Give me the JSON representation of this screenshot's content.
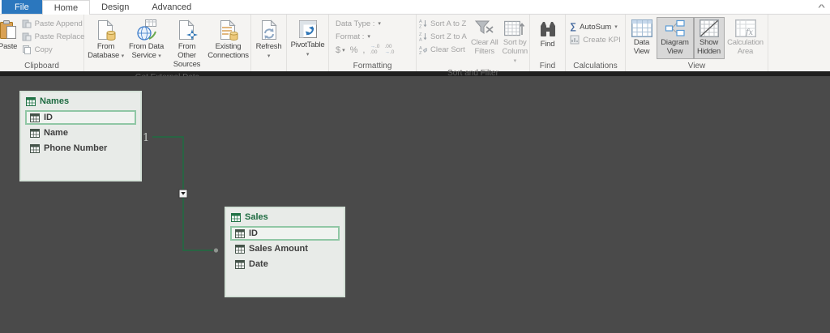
{
  "tabs": {
    "file": "File",
    "home": "Home",
    "design": "Design",
    "advanced": "Advanced"
  },
  "icons": {
    "dropdown": "▾",
    "sigma": "∑",
    "fx": "fx",
    "collapse_ribbon": "^"
  },
  "ribbon": {
    "clipboard": {
      "group_label": "Clipboard",
      "paste": "Paste",
      "paste_append": "Paste Append",
      "paste_replace": "Paste Replace",
      "copy": "Copy"
    },
    "external": {
      "group_label": "Get External Data",
      "from_database": "From Database",
      "from_data_service": "From Data Service",
      "from_other_sources": "From Other Sources",
      "existing_connections": "Existing Connections"
    },
    "refresh": {
      "label": "Refresh"
    },
    "pivottable": {
      "label": "PivotTable"
    },
    "formatting": {
      "group_label": "Formatting",
      "data_type": "Data Type :",
      "format": "Format :",
      "currency": "$",
      "percent": "%",
      "thousands": ",",
      "dec_small": ".0",
      "dec_large": ".00"
    },
    "sort_filter": {
      "group_label": "Sort and Filter",
      "sort_az": "Sort A to Z",
      "sort_za": "Sort Z to A",
      "clear_sort": "Clear Sort",
      "clear_all_line1": "Clear All",
      "clear_all_line2": "Filters",
      "sort_by_line1": "Sort by",
      "sort_by_line2": "Column"
    },
    "find": {
      "group_label": "Find",
      "label": "Find"
    },
    "calculations": {
      "group_label": "Calculations",
      "autosum": "AutoSum",
      "create_kpi": "Create KPI"
    },
    "view": {
      "group_label": "View",
      "data_view": "Data View",
      "diagram_view": "Diagram View",
      "show_hidden": "Show Hidden",
      "calculation_area": "Calculation Area"
    }
  },
  "diagram": {
    "tables": [
      {
        "name": "Names",
        "fields": [
          {
            "label": "ID",
            "selected": true
          },
          {
            "label": "Name",
            "selected": false
          },
          {
            "label": "Phone Number",
            "selected": false
          }
        ]
      },
      {
        "name": "Sales",
        "fields": [
          {
            "label": "ID",
            "selected": true
          },
          {
            "label": "Sales Amount",
            "selected": false
          },
          {
            "label": "Date",
            "selected": false
          }
        ]
      }
    ],
    "relationship": {
      "type": "one-to-many",
      "cardinality_one": "1",
      "cardinality_many": "*"
    }
  },
  "colors": {
    "file_tab": "#2b77be",
    "canvas_background": "#4a4a4a",
    "table_fill": "#e8ebe8",
    "table_header_text": "#1e6b41",
    "relationship_line": "#1e6c41",
    "selected_field_border": "#90c7a5",
    "pressed_button": "#d8d8d8"
  }
}
